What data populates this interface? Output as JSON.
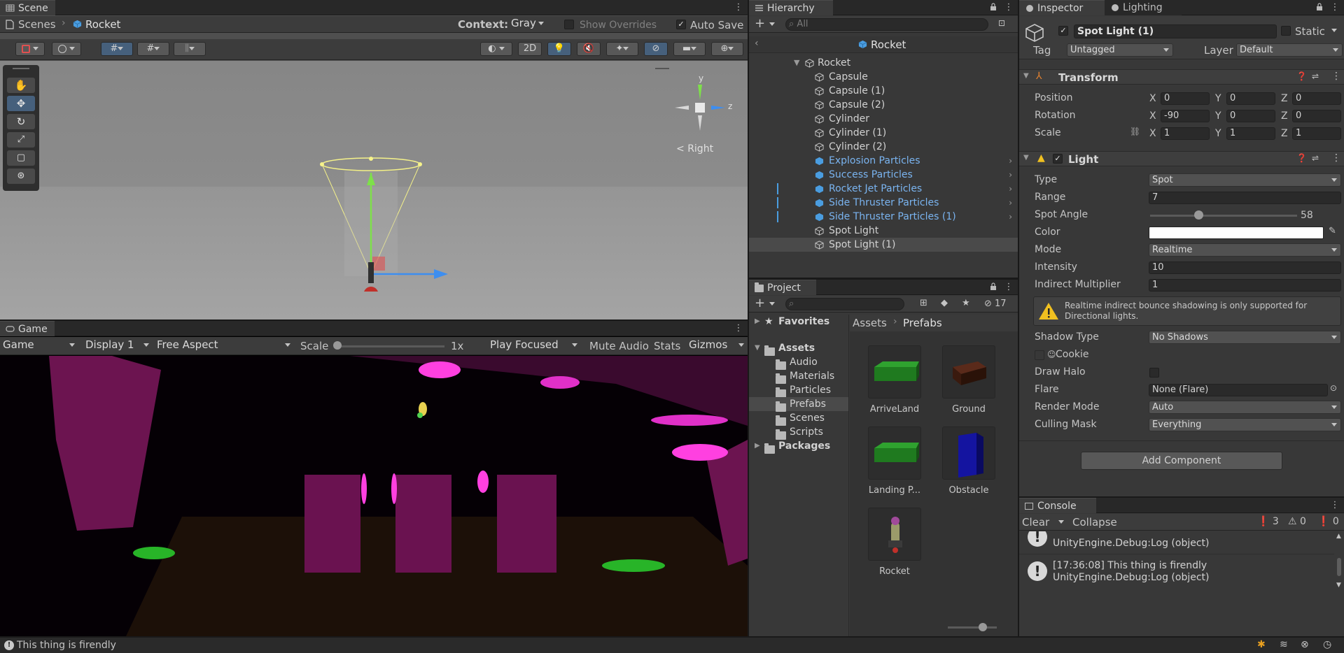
{
  "colors": {
    "accent_blue": "#46607c",
    "prefab_blue": "#7ab4f0",
    "panel_bg": "#383838",
    "warning_yellow": "#f0c020",
    "magenta": "#d020b0",
    "green": "#20a020"
  },
  "scene": {
    "tab_label": "Scene",
    "breadcrumb_root": "Scenes",
    "breadcrumb_current": "Rocket",
    "context_label": "Context:",
    "context_value": "Gray",
    "show_overrides": "Show Overrides",
    "auto_save": "Auto Save",
    "btn_2d": "2D",
    "gizmo_axis_y": "y",
    "gizmo_axis_z": "z",
    "view_label": "Right"
  },
  "game": {
    "tab_label": "Game",
    "mode": "Game",
    "display": "Display 1",
    "aspect": "Free Aspect",
    "scale_label": "Scale",
    "scale_value": "1x",
    "play_mode": "Play Focused",
    "mute": "Mute Audio",
    "stats": "Stats",
    "gizmos": "Gizmos"
  },
  "hierarchy": {
    "tab_label": "Hierarchy",
    "search_placeholder": "All",
    "header_title": "Rocket",
    "items": [
      {
        "label": "Rocket",
        "type": "root"
      },
      {
        "label": "Capsule",
        "type": "object"
      },
      {
        "label": "Capsule (1)",
        "type": "object"
      },
      {
        "label": "Capsule (2)",
        "type": "object"
      },
      {
        "label": "Cylinder",
        "type": "object"
      },
      {
        "label": "Cylinder (1)",
        "type": "object"
      },
      {
        "label": "Cylinder (2)",
        "type": "object"
      },
      {
        "label": "Explosion Particles",
        "type": "prefab"
      },
      {
        "label": "Success Particles",
        "type": "prefab"
      },
      {
        "label": "Rocket Jet Particles",
        "type": "prefab"
      },
      {
        "label": "Side Thruster Particles",
        "type": "prefab"
      },
      {
        "label": "Side Thruster Particles (1)",
        "type": "prefab"
      },
      {
        "label": "Spot Light",
        "type": "object"
      },
      {
        "label": "Spot Light (1)",
        "type": "selected"
      }
    ]
  },
  "project": {
    "tab_label": "Project",
    "hidden_count": "17",
    "tree": {
      "favorites": "Favorites",
      "assets": "Assets",
      "folders": [
        "Audio",
        "Materials",
        "Particles",
        "Prefabs",
        "Scenes",
        "Scripts"
      ],
      "packages": "Packages"
    },
    "breadcrumb_root": "Assets",
    "breadcrumb_current": "Prefabs",
    "assets": [
      {
        "name": "ArriveLand"
      },
      {
        "name": "Ground"
      },
      {
        "name": "Landing P..."
      },
      {
        "name": "Obstacle"
      },
      {
        "name": "Rocket"
      }
    ]
  },
  "inspector": {
    "tab_label": "Inspector",
    "tab2_label": "Lighting",
    "object_name": "Spot Light (1)",
    "static_label": "Static",
    "tag_label": "Tag",
    "tag_value": "Untagged",
    "layer_label": "Layer",
    "layer_value": "Default",
    "transform": {
      "title": "Transform",
      "position_label": "Position",
      "rotation_label": "Rotation",
      "scale_label": "Scale",
      "position": [
        "0",
        "0",
        "0"
      ],
      "rotation": [
        "-90",
        "0",
        "0"
      ],
      "scale": [
        "1",
        "1",
        "1"
      ],
      "x": "X",
      "y": "Y",
      "z": "Z"
    },
    "light": {
      "title": "Light",
      "type_label": "Type",
      "type_value": "Spot",
      "range_label": "Range",
      "range_value": "7",
      "spot_angle_label": "Spot Angle",
      "spot_angle_value": "58",
      "color_label": "Color",
      "mode_label": "Mode",
      "mode_value": "Realtime",
      "intensity_label": "Intensity",
      "intensity_value": "10",
      "indirect_label": "Indirect Multiplier",
      "indirect_value": "1",
      "warning": "Realtime indirect bounce shadowing is only supported for Directional lights.",
      "shadow_label": "Shadow Type",
      "shadow_value": "No Shadows",
      "cookie_label": "Cookie",
      "halo_label": "Draw Halo",
      "flare_label": "Flare",
      "flare_value": "None (Flare)",
      "render_label": "Render Mode",
      "render_value": "Auto",
      "culling_label": "Culling Mask",
      "culling_value": "Everything"
    },
    "add_component": "Add Component"
  },
  "console": {
    "tab_label": "Console",
    "clear": "Clear",
    "collapse": "Collapse",
    "count_errors": "3",
    "count_warnings": "0",
    "count_info": "0",
    "rows": [
      {
        "line1": "",
        "line2": "UnityEngine.Debug:Log (object)"
      },
      {
        "line1": "[17:36:08] This thing is firendly",
        "line2": "UnityEngine.Debug:Log (object)"
      }
    ]
  },
  "status_bar": {
    "message": "This thing is firendly"
  }
}
